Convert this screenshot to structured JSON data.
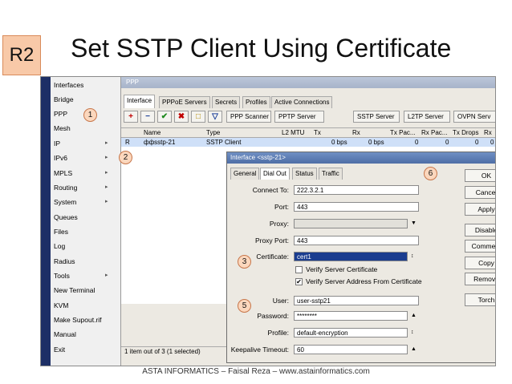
{
  "slide": {
    "badge": "R2",
    "title": "Set SSTP Client Using Certificate",
    "footer": "ASTA INFORMATICS – Faisal Reza – www.astainformatics.com"
  },
  "menu": [
    {
      "label": "Interfaces",
      "arrow": ""
    },
    {
      "label": "Bridge",
      "arrow": ""
    },
    {
      "label": "PPP",
      "arrow": ""
    },
    {
      "label": "Mesh",
      "arrow": ""
    },
    {
      "label": "IP",
      "arrow": "▸"
    },
    {
      "label": "IPv6",
      "arrow": "▸"
    },
    {
      "label": "MPLS",
      "arrow": "▸"
    },
    {
      "label": "Routing",
      "arrow": "▸"
    },
    {
      "label": "System",
      "arrow": "▸"
    },
    {
      "label": "Queues",
      "arrow": ""
    },
    {
      "label": "Files",
      "arrow": ""
    },
    {
      "label": "Log",
      "arrow": ""
    },
    {
      "label": "Radius",
      "arrow": ""
    },
    {
      "label": "Tools",
      "arrow": "▸"
    },
    {
      "label": "New Terminal",
      "arrow": ""
    },
    {
      "label": "KVM",
      "arrow": ""
    },
    {
      "label": "Make Supout.rif",
      "arrow": ""
    },
    {
      "label": "Manual",
      "arrow": ""
    },
    {
      "label": "Exit",
      "arrow": ""
    }
  ],
  "ppp": {
    "window_title": "PPP",
    "tabs": [
      "Interface",
      "PPPoE Servers",
      "Secrets",
      "Profiles",
      "Active Connections"
    ],
    "toolbar": {
      "add": "+",
      "remove": "−",
      "enable": "✔",
      "disable": "✖",
      "comment": "□",
      "filter": "▽",
      "buttons": [
        "PPP Scanner",
        "PPTP Server",
        "SSTP Server",
        "L2TP Server",
        "OVPN Serv"
      ]
    },
    "columns": [
      "Name",
      "Type",
      "L2 MTU",
      "Tx",
      "Rx",
      "Tx Pac...",
      "Rx Pac...",
      "Tx Drops",
      "Rx"
    ],
    "row": {
      "flag": "R",
      "name": "ффsstp-21",
      "type": "SSTP Client",
      "tx": "0 bps",
      "rx": "0 bps",
      "txp": "0",
      "rxp": "0",
      "txd": "0",
      "rxd": "0"
    },
    "status": "1 item out of 3 (1 selected)"
  },
  "dialog": {
    "title": "Interface <sstp-21>",
    "tabs": [
      "General",
      "Dial Out",
      "Status",
      "Traffic"
    ],
    "fields": {
      "connect_to_label": "Connect To:",
      "connect_to": "222.3.2.1",
      "port_label": "Port:",
      "port": "443",
      "proxy_label": "Proxy:",
      "proxy": "",
      "proxy_port_label": "Proxy Port:",
      "proxy_port": "443",
      "certificate_label": "Certificate:",
      "certificate": "cert1",
      "verify_cert_label": "Verify Server Certificate",
      "verify_cert": false,
      "verify_addr_label": "Verify Server Address From Certificate",
      "verify_addr": true,
      "user_label": "User:",
      "user": "user-sstp21",
      "password_label": "Password:",
      "password": "********",
      "profile_label": "Profile:",
      "profile": "default-encryption",
      "keepalive_label": "Keepalive Timeout:",
      "keepalive": "60"
    },
    "buttons": [
      "OK",
      "Cancel",
      "Apply",
      "Disable",
      "Comment",
      "Copy",
      "Remove",
      "Torch"
    ],
    "window_buttons": {
      "minimize": "▭",
      "close": "✖"
    }
  },
  "callouts": [
    "1",
    "2",
    "3",
    "5",
    "6"
  ],
  "icons": {
    "dropdown": "▼",
    "updown": "↕",
    "up": "▲",
    "check": "✔"
  },
  "colors": {
    "badge_bg": "#f8c9a8",
    "selection": "#1a3c8f",
    "dialog_title": "#4e6ea6"
  }
}
